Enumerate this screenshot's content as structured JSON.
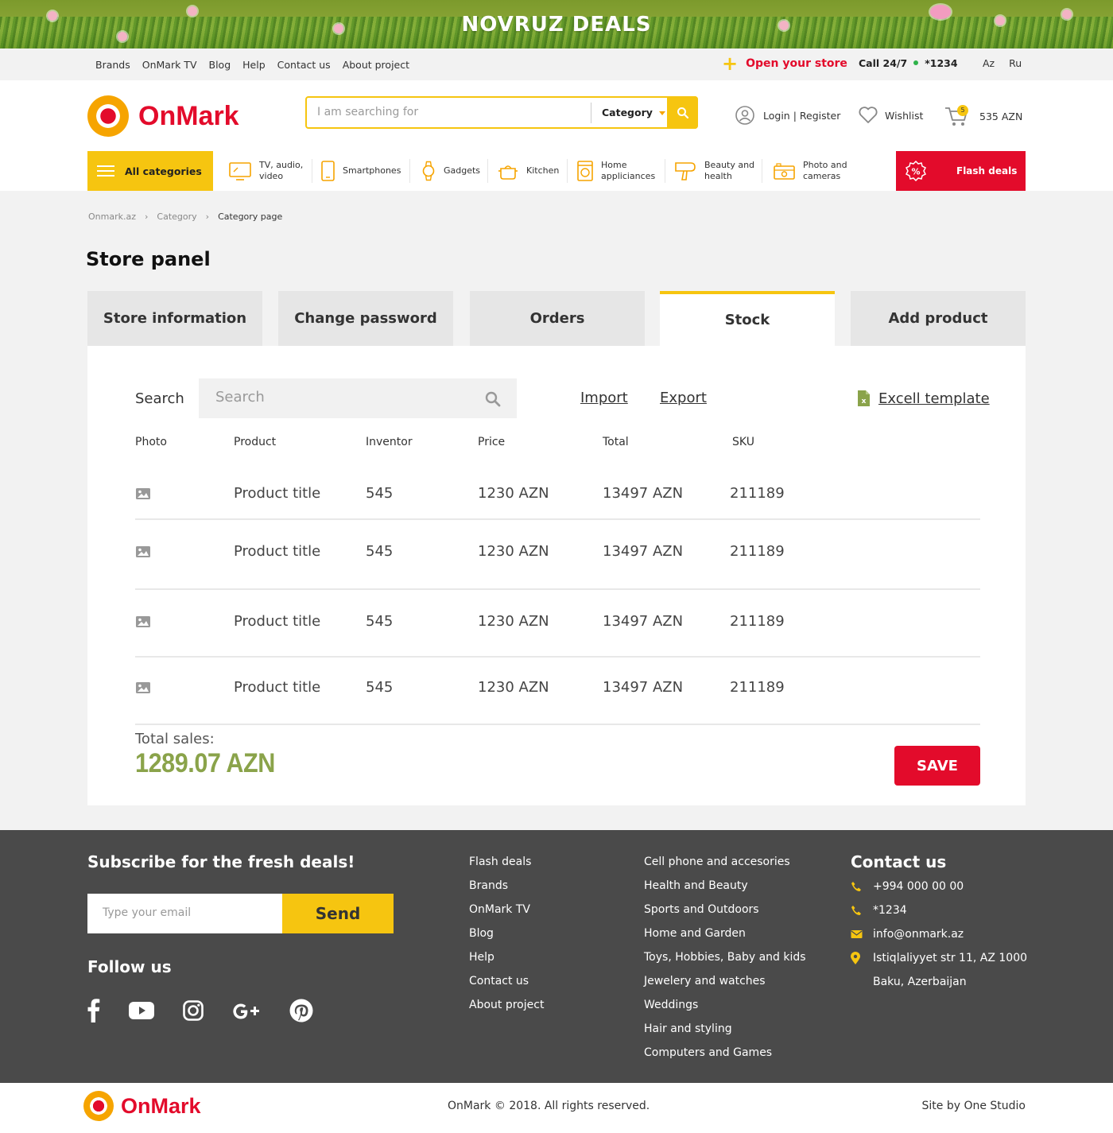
{
  "banner": {
    "title": "NOVRUZ DEALS"
  },
  "toplinks": {
    "items": [
      "Brands",
      "OnMark TV",
      "Blog",
      "Help",
      "Contact us",
      "About project"
    ],
    "open_store": "Open your store",
    "call_label": "Call 24/7",
    "call_number": "*1234",
    "languages": [
      "Az",
      "Ru"
    ]
  },
  "header": {
    "logo_text": "OnMark",
    "search_placeholder": "I am searching for",
    "category_label": "Category",
    "login": "Login | Register",
    "wishlist": "Wishlist",
    "cart_count": "5",
    "cart_total": "535 AZN"
  },
  "catnav": {
    "all_categories": "All categories",
    "items": [
      {
        "label": "TV, audio,\nvideo",
        "icon": "tv-icon"
      },
      {
        "label": "Smartphones",
        "icon": "smartphone-icon"
      },
      {
        "label": "Gadgets",
        "icon": "watch-icon"
      },
      {
        "label": "Kitchen",
        "icon": "pot-icon"
      },
      {
        "label": "Home\nappliciances",
        "icon": "washing-machine-icon"
      },
      {
        "label": "Beauty and\nhealth",
        "icon": "hair-dryer-icon"
      },
      {
        "label": "Photo and\ncameras",
        "icon": "camera-icon"
      }
    ],
    "flash": "Flash deals"
  },
  "breadcrumb": [
    "Onmark.az",
    "Category",
    "Category page"
  ],
  "page_title": "Store panel",
  "tabs": [
    {
      "label": "Store information",
      "active": false
    },
    {
      "label": "Change password",
      "active": false
    },
    {
      "label": "Orders",
      "active": false
    },
    {
      "label": "Stock",
      "active": true
    },
    {
      "label": "Add product",
      "active": false
    }
  ],
  "stock": {
    "search_label": "Search",
    "search_placeholder": "Search",
    "import": "Import",
    "export": "Export",
    "excel": "Excell template",
    "columns": [
      "Photo",
      "Product",
      "Inventor",
      "Price",
      "Total",
      "SKU"
    ],
    "rows": [
      {
        "product": "Product title",
        "inventory": "545",
        "price": "1230 AZN",
        "total": "13497 AZN",
        "sku": "211189"
      },
      {
        "product": "Product title",
        "inventory": "545",
        "price": "1230 AZN",
        "total": "13497 AZN",
        "sku": "211189"
      },
      {
        "product": "Product title",
        "inventory": "545",
        "price": "1230 AZN",
        "total": "13497 AZN",
        "sku": "211189"
      },
      {
        "product": "Product title",
        "inventory": "545",
        "price": "1230 AZN",
        "total": "13497 AZN",
        "sku": "211189"
      }
    ],
    "total_label": "Total sales:",
    "total_value": "1289.07 AZN",
    "save": "SAVE"
  },
  "footer": {
    "subscribe_title": "Subscribe for the fresh deals!",
    "email_placeholder": "Type your email",
    "send": "Send",
    "follow": "Follow us",
    "social": [
      "facebook-icon",
      "youtube-icon",
      "instagram-icon",
      "google-plus-icon",
      "pinterest-icon"
    ],
    "links1": [
      "Flash deals",
      "Brands",
      "OnMark TV",
      "Blog",
      "Help",
      "Contact us",
      "About project"
    ],
    "links2": [
      "Cell phone and accesories",
      "Health and Beauty",
      "Sports and Outdoors",
      "Home and Garden",
      "Toys, Hobbies, Baby and kids",
      "Jewelery and watches",
      "Weddings",
      "Hair and styling",
      "Computers and Games"
    ],
    "contact_title": "Contact us",
    "phone": "+994 000 00 00",
    "short": "*1234",
    "email": "info@onmark.az",
    "address1": "Istiqlaliyyet str 11, AZ 1000",
    "address2": "Baku, Azerbaijan",
    "copyright": "OnMark © 2018. All rights reserved.",
    "site_by": "Site by One Studio"
  },
  "colors": {
    "accent": "#f6c510",
    "brand_red": "#e30b2b",
    "footer_bg": "#4a4a4a",
    "total_green": "#8aa34a"
  }
}
